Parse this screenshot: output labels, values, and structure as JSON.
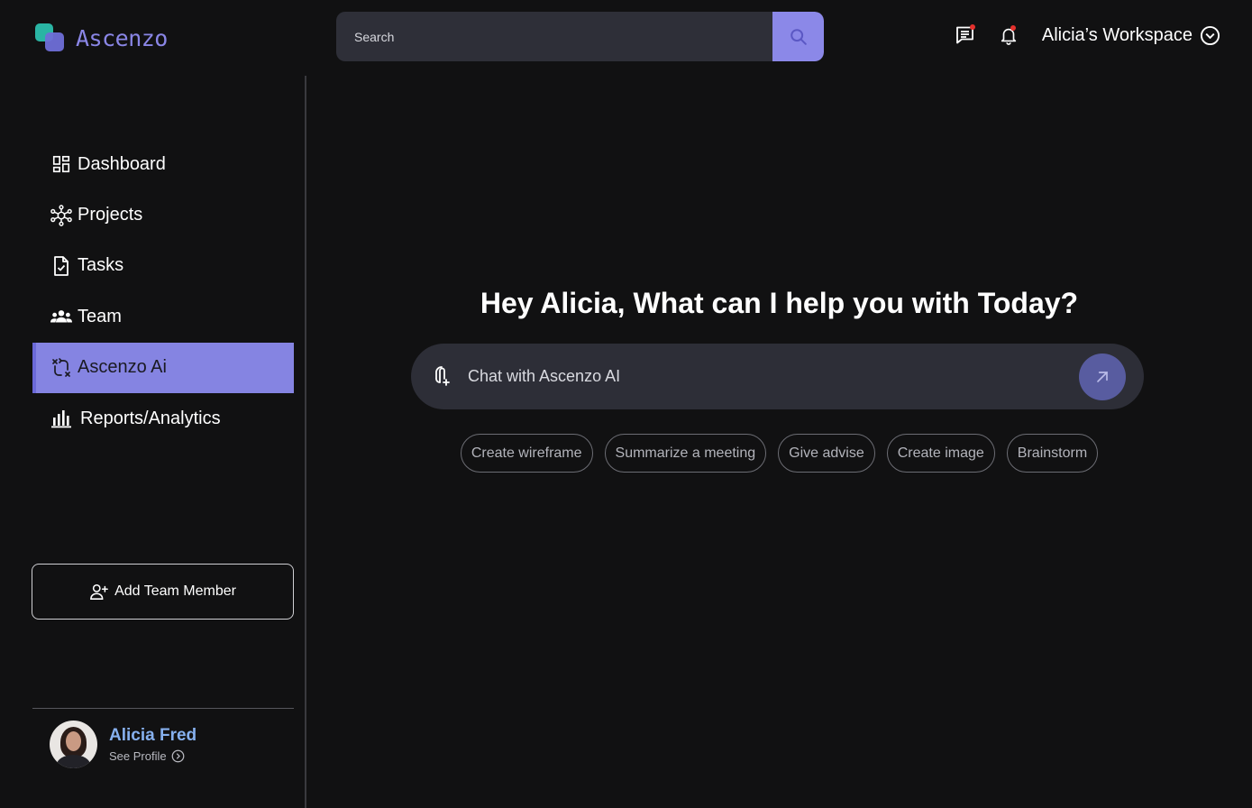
{
  "app": {
    "logo_text": "Ascenzo"
  },
  "search": {
    "placeholder": "Search"
  },
  "header": {
    "workspace_label": "Alicia’s Workspace",
    "icons": [
      "messages-icon",
      "bell-icon",
      "chevron-down-circle-icon"
    ],
    "notification_color": "#e5312d"
  },
  "sidebar": {
    "items": [
      {
        "label": "Dashboard",
        "icon": "dashboard-icon",
        "active": false
      },
      {
        "label": "Projects",
        "icon": "projects-network-icon",
        "active": false
      },
      {
        "label": "Tasks",
        "icon": "task-document-icon",
        "active": false
      },
      {
        "label": "Team",
        "icon": "team-icon",
        "active": false
      },
      {
        "label": "Ascenzo Ai",
        "icon": "ai-sparkle-icon",
        "active": true
      },
      {
        "label": "Reports/Analytics",
        "icon": "bar-chart-icon",
        "active": false
      }
    ],
    "add_member_label": "Add Team Member"
  },
  "profile": {
    "name": "Alicia Fred",
    "link_label": "See Profile"
  },
  "main": {
    "headline": "Hey Alicia, What can I help you with Today?",
    "chat_placeholder": "Chat with Ascenzo AI",
    "suggestions": [
      "Create wireframe",
      "Summarize a meeting",
      "Give advise",
      "Create image",
      "Brainstorm"
    ]
  },
  "colors": {
    "background": "#111112",
    "accent": "#8584e2",
    "search_button": "#8b88e8",
    "send_button": "#585ca0",
    "profile_name": "#86b0ee",
    "logo_teal": "#2ab5a4"
  }
}
